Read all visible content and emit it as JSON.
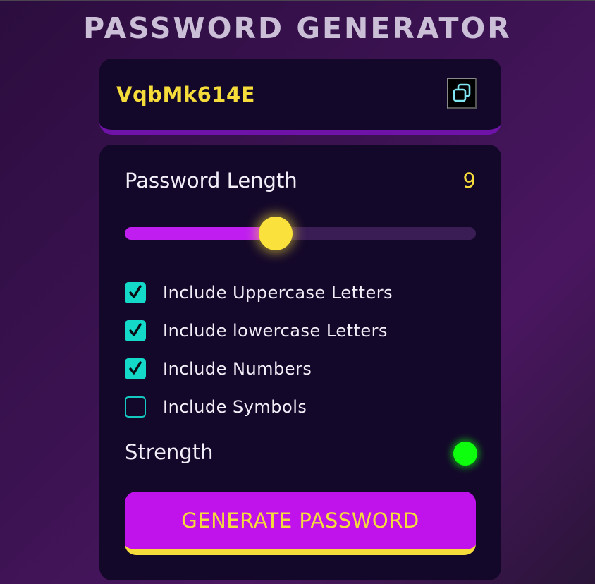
{
  "title": "PASSWORD GENERATOR",
  "display": {
    "password": "VqbMk614E",
    "copy_icon": "copy-icon"
  },
  "settings": {
    "length_label": "Password Length",
    "length_value": "9",
    "slider_fraction": 0.43,
    "options": [
      {
        "label": "Include Uppercase Letters",
        "checked": true
      },
      {
        "label": "Include lowercase Letters",
        "checked": true
      },
      {
        "label": "Include Numbers",
        "checked": true
      },
      {
        "label": "Include Symbols",
        "checked": false
      }
    ],
    "strength_label": "Strength",
    "strength_color": "#0dff0d",
    "generate_label": "GENERATE PASSWORD"
  },
  "colors": {
    "accent_yellow": "#f6dc3a",
    "accent_purple": "#c013ec",
    "checkbox_teal": "#14d9c9",
    "panel_bg": "#14082a"
  }
}
